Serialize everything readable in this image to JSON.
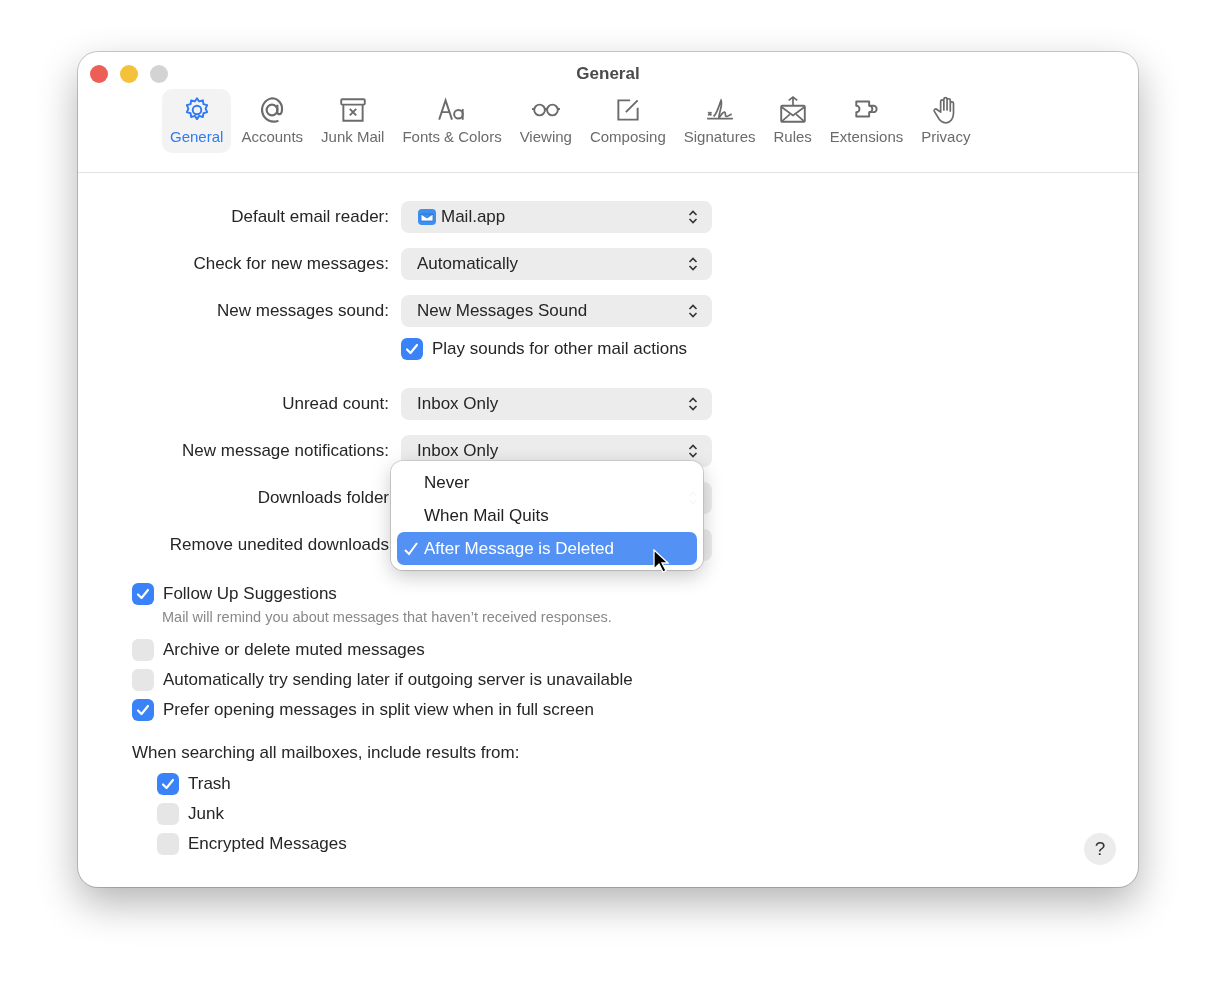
{
  "window": {
    "title": "General"
  },
  "tabs": [
    {
      "label": "General",
      "selected": true
    },
    {
      "label": "Accounts",
      "selected": false
    },
    {
      "label": "Junk Mail",
      "selected": false
    },
    {
      "label": "Fonts & Colors",
      "selected": false
    },
    {
      "label": "Viewing",
      "selected": false
    },
    {
      "label": "Composing",
      "selected": false
    },
    {
      "label": "Signatures",
      "selected": false
    },
    {
      "label": "Rules",
      "selected": false
    },
    {
      "label": "Extensions",
      "selected": false
    },
    {
      "label": "Privacy",
      "selected": false
    }
  ],
  "form_rows": [
    {
      "kind": "app-popup",
      "label": "Default email reader:",
      "value": "Mail.app"
    },
    {
      "kind": "popup",
      "label": "Check for new messages:",
      "value": "Automatically"
    },
    {
      "kind": "popup",
      "label": "New messages sound:",
      "value": "New Messages Sound"
    },
    {
      "kind": "checkbox",
      "label": "Play sounds for other mail actions",
      "checked": true
    },
    {
      "kind": "popup",
      "label": "Unread count:",
      "value": "Inbox Only"
    },
    {
      "kind": "popup",
      "label": "New message notifications:",
      "value": "Inbox Only"
    },
    {
      "kind": "covered-popup",
      "label": "Downloads folder"
    },
    {
      "kind": "covered-popup",
      "label": "Remove unedited downloads"
    }
  ],
  "popup_menu": {
    "items": [
      {
        "label": "Never",
        "selected": false
      },
      {
        "label": "When Mail Quits",
        "selected": false
      },
      {
        "label": "After Message is Deleted",
        "selected": true
      }
    ]
  },
  "options": [
    {
      "label": "Follow Up Suggestions",
      "checked": true,
      "note": "Mail will remind you about messages that haven’t received responses."
    },
    {
      "label": "Archive or delete muted messages",
      "checked": false
    },
    {
      "label": "Automatically try sending later if outgoing server is unavailable",
      "checked": false
    },
    {
      "label": "Prefer opening messages in split view when in full screen",
      "checked": true
    }
  ],
  "search_section": {
    "heading": "When searching all mailboxes, include results from:",
    "options": [
      {
        "label": "Trash",
        "checked": true
      },
      {
        "label": "Junk",
        "checked": false
      },
      {
        "label": "Encrypted Messages",
        "checked": false
      }
    ]
  },
  "help_button": {
    "label": "?"
  }
}
